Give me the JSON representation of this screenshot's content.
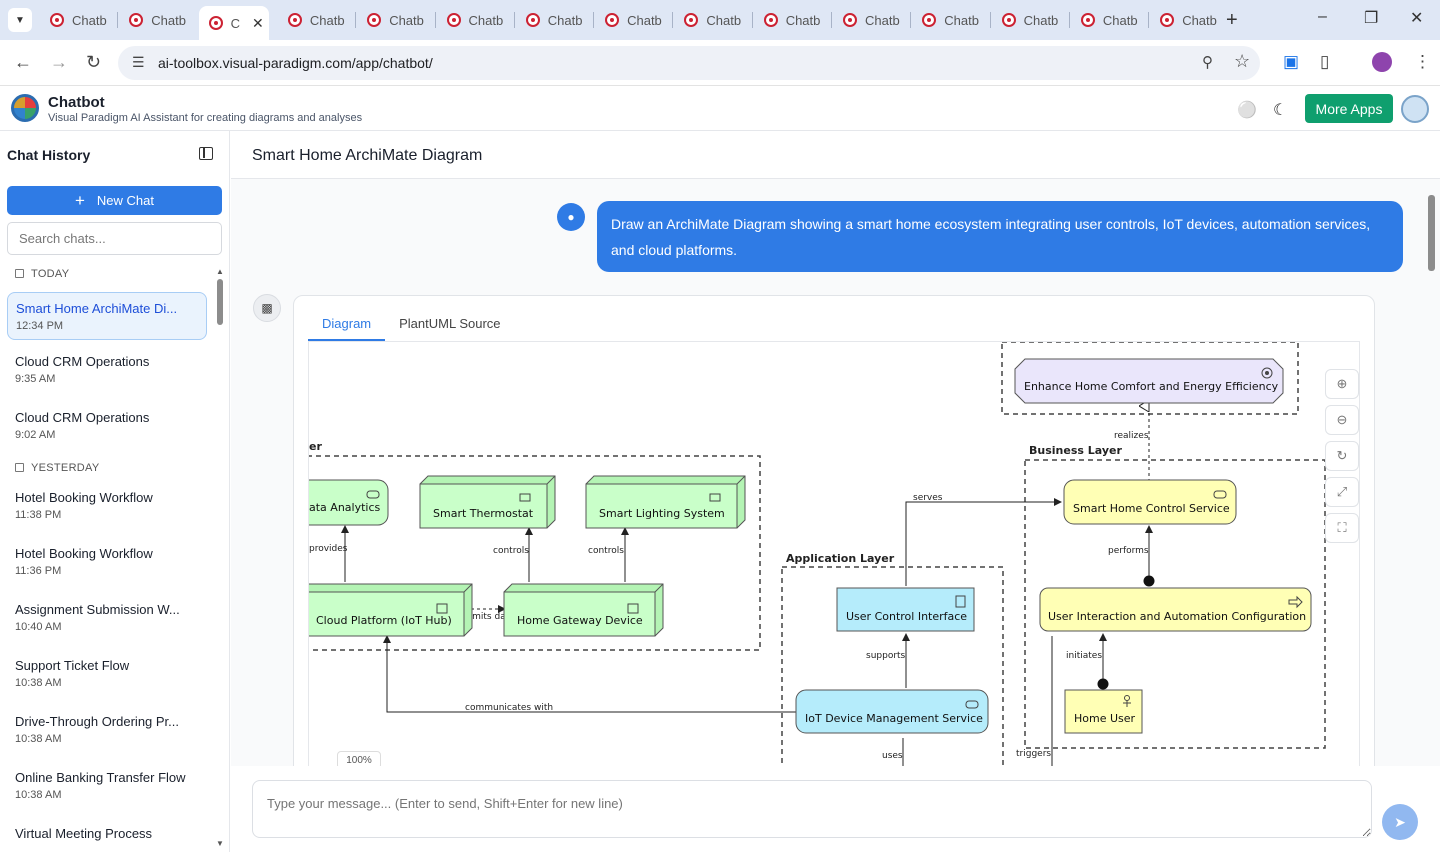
{
  "browser": {
    "tabs": [
      {
        "label": "Chatb",
        "active": false
      },
      {
        "label": "Chatb",
        "active": false
      },
      {
        "label": "C",
        "active": true
      },
      {
        "label": "Chatb",
        "active": false
      },
      {
        "label": "Chatb",
        "active": false
      },
      {
        "label": "Chatb",
        "active": false
      },
      {
        "label": "Chatb",
        "active": false
      },
      {
        "label": "Chatb",
        "active": false
      },
      {
        "label": "Chatb",
        "active": false
      },
      {
        "label": "Chatb",
        "active": false
      },
      {
        "label": "Chatb",
        "active": false
      },
      {
        "label": "Chatb",
        "active": false
      },
      {
        "label": "Chatb",
        "active": false
      },
      {
        "label": "Chatb",
        "active": false
      },
      {
        "label": "Chatb",
        "active": false
      }
    ],
    "url": "ai-toolbox.visual-paradigm.com/app/chatbot/"
  },
  "app": {
    "title": "Chatbot",
    "subtitle": "Visual Paradigm AI Assistant for creating diagrams and analyses",
    "more_apps": "More Apps",
    "brand_color": "#0f9f6e"
  },
  "sidebar": {
    "title": "Chat History",
    "new_chat": "New Chat",
    "search_placeholder": "Search chats...",
    "groups": [
      {
        "label": "TODAY",
        "items": [
          {
            "title": "Smart Home ArchiMate Di...",
            "time": "12:34 PM",
            "selected": true
          },
          {
            "title": "Cloud CRM Operations",
            "time": "9:35 AM"
          },
          {
            "title": "Cloud CRM Operations",
            "time": "9:02 AM"
          }
        ]
      },
      {
        "label": "YESTERDAY",
        "items": [
          {
            "title": "Hotel Booking Workflow",
            "time": "11:38 PM"
          },
          {
            "title": "Hotel Booking Workflow",
            "time": "11:36 PM"
          },
          {
            "title": "Assignment Submission W...",
            "time": "10:40 AM"
          },
          {
            "title": "Support Ticket Flow",
            "time": "10:38 AM"
          },
          {
            "title": "Drive-Through Ordering Pr...",
            "time": "10:38 AM"
          },
          {
            "title": "Online Banking Transfer Flow",
            "time": "10:38 AM"
          },
          {
            "title": "Virtual Meeting Process",
            "time": ""
          }
        ]
      }
    ]
  },
  "chat": {
    "title": "Smart Home ArchiMate Diagram",
    "user_message": "Draw an ArchiMate Diagram showing a smart home ecosystem integrating user controls, IoT devices, automation services, and cloud platforms.",
    "tabs": [
      "Diagram",
      "PlantUML Source"
    ],
    "zoom": "100%",
    "composer_placeholder": "Type your message... (Enter to send, Shift+Enter for new line)"
  },
  "diagram": {
    "groups": [
      "er",
      "Application Layer",
      "Business Layer"
    ],
    "elements": {
      "goal": "Enhance Home Comfort and Energy Efficiency",
      "analytics": "ata Analytics",
      "thermostat": "Smart Thermostat",
      "lighting": "Smart Lighting System",
      "cloud": "Cloud Platform (IoT Hub)",
      "gateway": "Home Gateway Device",
      "uci": "User Control Interface",
      "iotdm": "IoT Device Management Service",
      "shcs": "Smart Home Control Service",
      "uiac": "User Interaction and Automation Configuration",
      "user": "Home User"
    },
    "relations": {
      "realizes": "realizes",
      "serves": "serves",
      "performs": "performs",
      "provides": "provides",
      "controls1": "controls",
      "controls2": "controls",
      "transmits": "transmits data to",
      "supports": "supports",
      "initiates": "initiates",
      "communicates": "communicates with",
      "uses": "uses",
      "triggers": "triggers"
    },
    "colors": {
      "technology": "#c9ffc9",
      "application": "#b5ecfb",
      "business": "#ffffb5",
      "motivation": "#eae6fb"
    }
  }
}
